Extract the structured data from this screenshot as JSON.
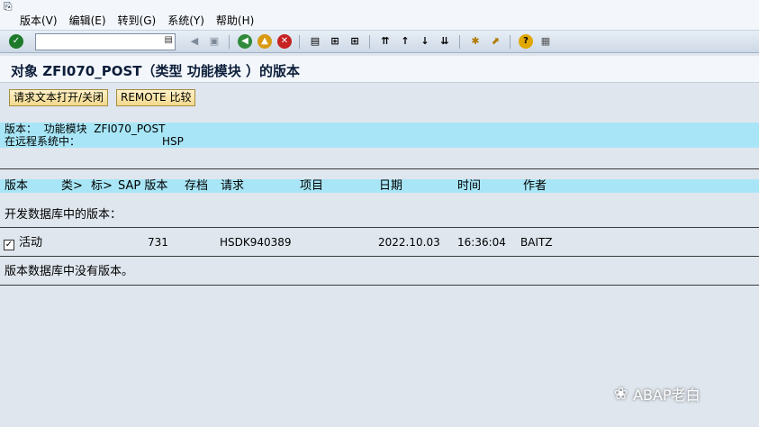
{
  "menu": {
    "items": [
      "版本(V)",
      "编辑(E)",
      "转到(G)",
      "系统(Y)",
      "帮助(H)"
    ]
  },
  "toolbar": {
    "command_value": "",
    "icons": [
      "check-icon",
      "dropdown-icon",
      "back-arrow-icon",
      "save-icon",
      "nav-back-icon",
      "nav-exit-icon",
      "nav-cancel-icon",
      "print-icon",
      "find-icon",
      "find-next-icon",
      "first-page-icon",
      "prev-page-icon",
      "next-page-icon",
      "last-page-icon",
      "new-session-icon",
      "shortcut-icon",
      "help-icon",
      "layout-icon"
    ]
  },
  "title": "对象 ZFI070_POST（类型 功能模块 ）的版本",
  "app_toolbar": {
    "toggle_request_text": "请求文本打开/关闭",
    "remote_compare": "REMOTE 比较"
  },
  "header": {
    "version_line": "版本：  功能模块  ZFI070_POST",
    "remote_label": "在远程系统中：",
    "remote_system": "HSP"
  },
  "columns": {
    "version": "版本",
    "type": "类>",
    "flag": "标>",
    "sap_version": "SAP 版本",
    "archive": "存档",
    "request": "请求",
    "item": "项目",
    "date": "日期",
    "time": "时间",
    "author": "作者"
  },
  "dev_db_heading": "开发数据库中的版本：",
  "rows": [
    {
      "checked": true,
      "status": "活动",
      "sap_version": "731",
      "request": "HSDK940389",
      "date": "2022.10.03",
      "time": "16:36:04",
      "author": "BAITZ"
    }
  ],
  "no_versions_msg": "版本数据库中没有版本。",
  "watermark": "ABAP老白",
  "colors": {
    "highlight": "#a8e6f7",
    "button_bg": "#f2d98c",
    "page_bg": "#dfe6ee"
  }
}
